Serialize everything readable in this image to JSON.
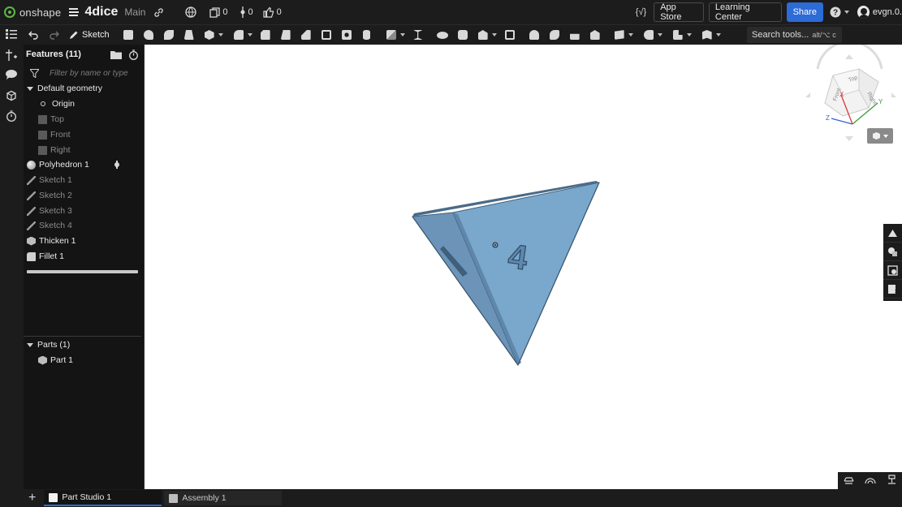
{
  "colors": {
    "bar_bg": "#1c1c1c",
    "panel_bg": "#141414",
    "accent": "#2d6bd6",
    "brand_green": "#5fb744",
    "part_blue": "#7aa7cc"
  },
  "topbar": {
    "logo_text": "onshape",
    "document_name": "4dice",
    "branch": "Main",
    "versions_count": "0",
    "branch_count": "0",
    "likes_count": "0",
    "app_store_label": "App Store",
    "learning_center_label": "Learning Center",
    "share_label": "Share",
    "user_name": "evgn.0."
  },
  "toolbar": {
    "sketch_label": "Sketch",
    "search_label": "Search tools...",
    "search_hint": "alt/⌥ c"
  },
  "features": {
    "title": "Features (11)",
    "filter_placeholder": "Filter by name or type",
    "default_geometry_label": "Default geometry",
    "items": [
      {
        "label": "Origin"
      },
      {
        "label": "Top"
      },
      {
        "label": "Front"
      },
      {
        "label": "Right"
      },
      {
        "label": "Polyhedron 1"
      },
      {
        "label": "Sketch 1"
      },
      {
        "label": "Sketch 2"
      },
      {
        "label": "Sketch 3"
      },
      {
        "label": "Sketch 4"
      },
      {
        "label": "Thicken 1"
      },
      {
        "label": "Fillet 1"
      }
    ]
  },
  "parts": {
    "title": "Parts (1)",
    "items": [
      {
        "label": "Part 1"
      }
    ]
  },
  "viewcube": {
    "faces": [
      "Right",
      "Top",
      "Front"
    ],
    "axes": [
      "X",
      "Y",
      "Z"
    ]
  },
  "tabs": [
    {
      "label": "Part Studio 1",
      "active": true
    },
    {
      "label": "Assembly 1",
      "active": false
    }
  ],
  "part_engraving": "4"
}
